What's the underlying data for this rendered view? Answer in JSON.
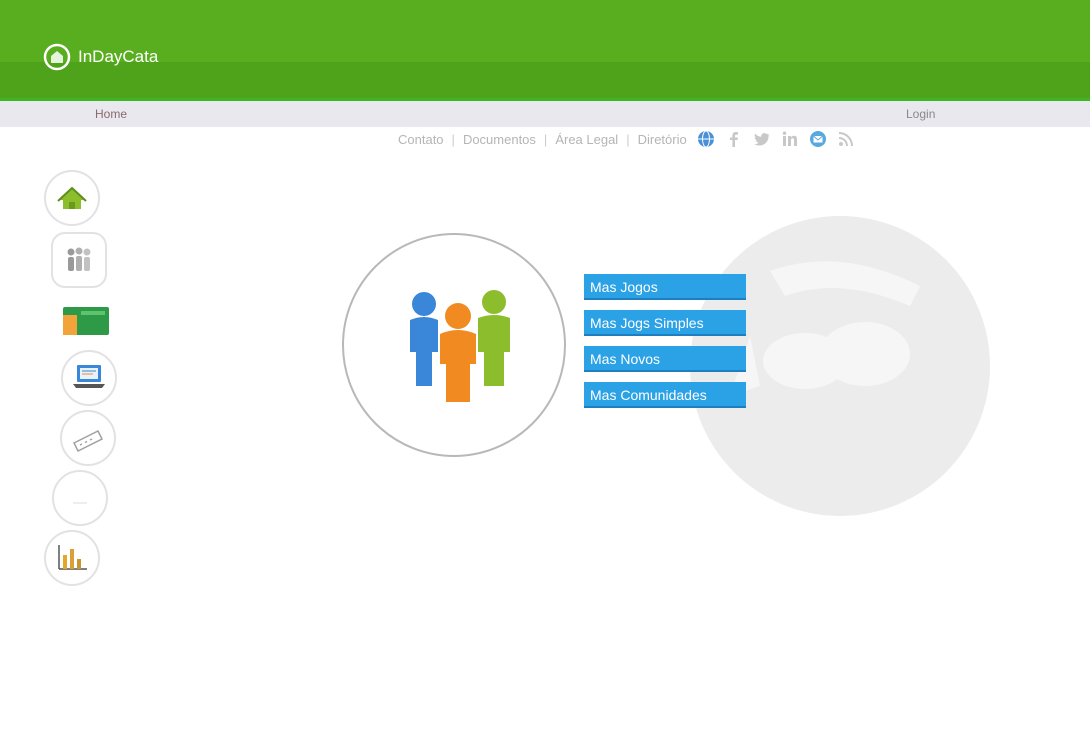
{
  "header": {
    "logo_text": "InDayCata"
  },
  "breadcrumb": {
    "left": "Home",
    "right": "Login"
  },
  "nav": {
    "links": [
      "Contato",
      "Documentos",
      "Área Legal",
      "Diretório"
    ]
  },
  "sidebar": {
    "items": [
      {
        "icon": "home-icon"
      },
      {
        "icon": "people-icon"
      },
      {
        "icon": "card-icon"
      },
      {
        "icon": "laptop-icon"
      },
      {
        "icon": "ticket-icon"
      },
      {
        "icon": "blank-icon"
      },
      {
        "icon": "bar-chart-icon"
      }
    ]
  },
  "main": {
    "menu": [
      {
        "label": "Mas Jogos"
      },
      {
        "label": "Mas Jogs Simples"
      },
      {
        "label": "Mas Novos"
      },
      {
        "label": "Mas Comunidades"
      }
    ]
  },
  "colors": {
    "header_green": "#58ae1f",
    "button_blue": "#2ba1e6",
    "figure_blue": "#3a86d9",
    "figure_orange": "#f28a22",
    "figure_green": "#8cbd2c"
  }
}
